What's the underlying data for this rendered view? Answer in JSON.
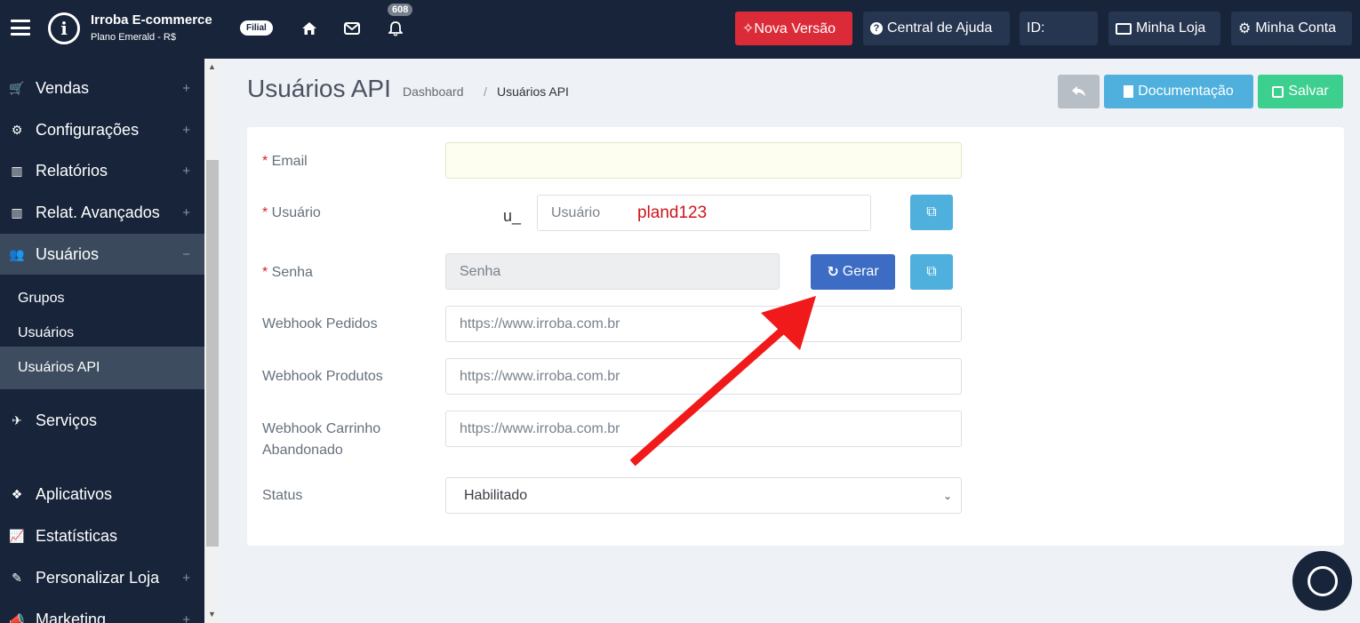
{
  "topbar": {
    "brand_title": "Irroba E-commerce",
    "brand_sub": "Plano Emerald - R$",
    "filial": "Filial",
    "notif_count": "608",
    "new_version": "✧Nova Versão",
    "help": "Central de Ajuda",
    "id_label": "ID:",
    "my_store": "Minha Loja",
    "my_account": "Minha Conta"
  },
  "sidebar": {
    "items": [
      {
        "label": "Vendas",
        "icon": "cart-icon"
      },
      {
        "label": "Configurações",
        "icon": "gears-icon"
      },
      {
        "label": "Relatórios",
        "icon": "bar-chart-icon"
      },
      {
        "label": "Relat. Avançados",
        "icon": "bar-chart-icon"
      },
      {
        "label": "Usuários",
        "icon": "users-icon"
      },
      {
        "label": "Serviços",
        "icon": "rocket-icon"
      },
      {
        "label": "Aplicativos",
        "icon": "cubes-icon"
      },
      {
        "label": "Estatísticas",
        "icon": "line-chart-icon"
      },
      {
        "label": "Personalizar Loja",
        "icon": "brush-icon"
      },
      {
        "label": "Marketing",
        "icon": "bullhorn-icon"
      }
    ],
    "subitems": [
      "Grupos",
      "Usuários",
      "Usuários API"
    ]
  },
  "page": {
    "title": "Usuários API",
    "breadcrumb_home": "Dashboard",
    "breadcrumb_sep": "/",
    "breadcrumb_current": "Usuários API"
  },
  "actions": {
    "docs": "Documentação",
    "save": "Salvar"
  },
  "form": {
    "email_label": "Email",
    "user_label": "Usuário",
    "user_prefix": "u_",
    "user_placeholder": "Usuário",
    "user_annotation": "pland123",
    "password_label": "Senha",
    "password_placeholder": "Senha",
    "generate": "Gerar",
    "wh_orders_label": "Webhook Pedidos",
    "wh_products_label": "Webhook Produtos",
    "wh_cart_label_1": "Webhook Carrinho",
    "wh_cart_label_2": "Abandonado",
    "wh_placeholder": "https://www.irroba.com.br",
    "status_label": "Status",
    "status_value": "Habilitado"
  },
  "colors": {
    "topbar": "#17243a",
    "red_button": "#dc2b38",
    "info": "#4fb0de",
    "success": "#3ccf8e",
    "primary": "#3c6cc4",
    "annotation_arrow": "#f01a1a"
  }
}
